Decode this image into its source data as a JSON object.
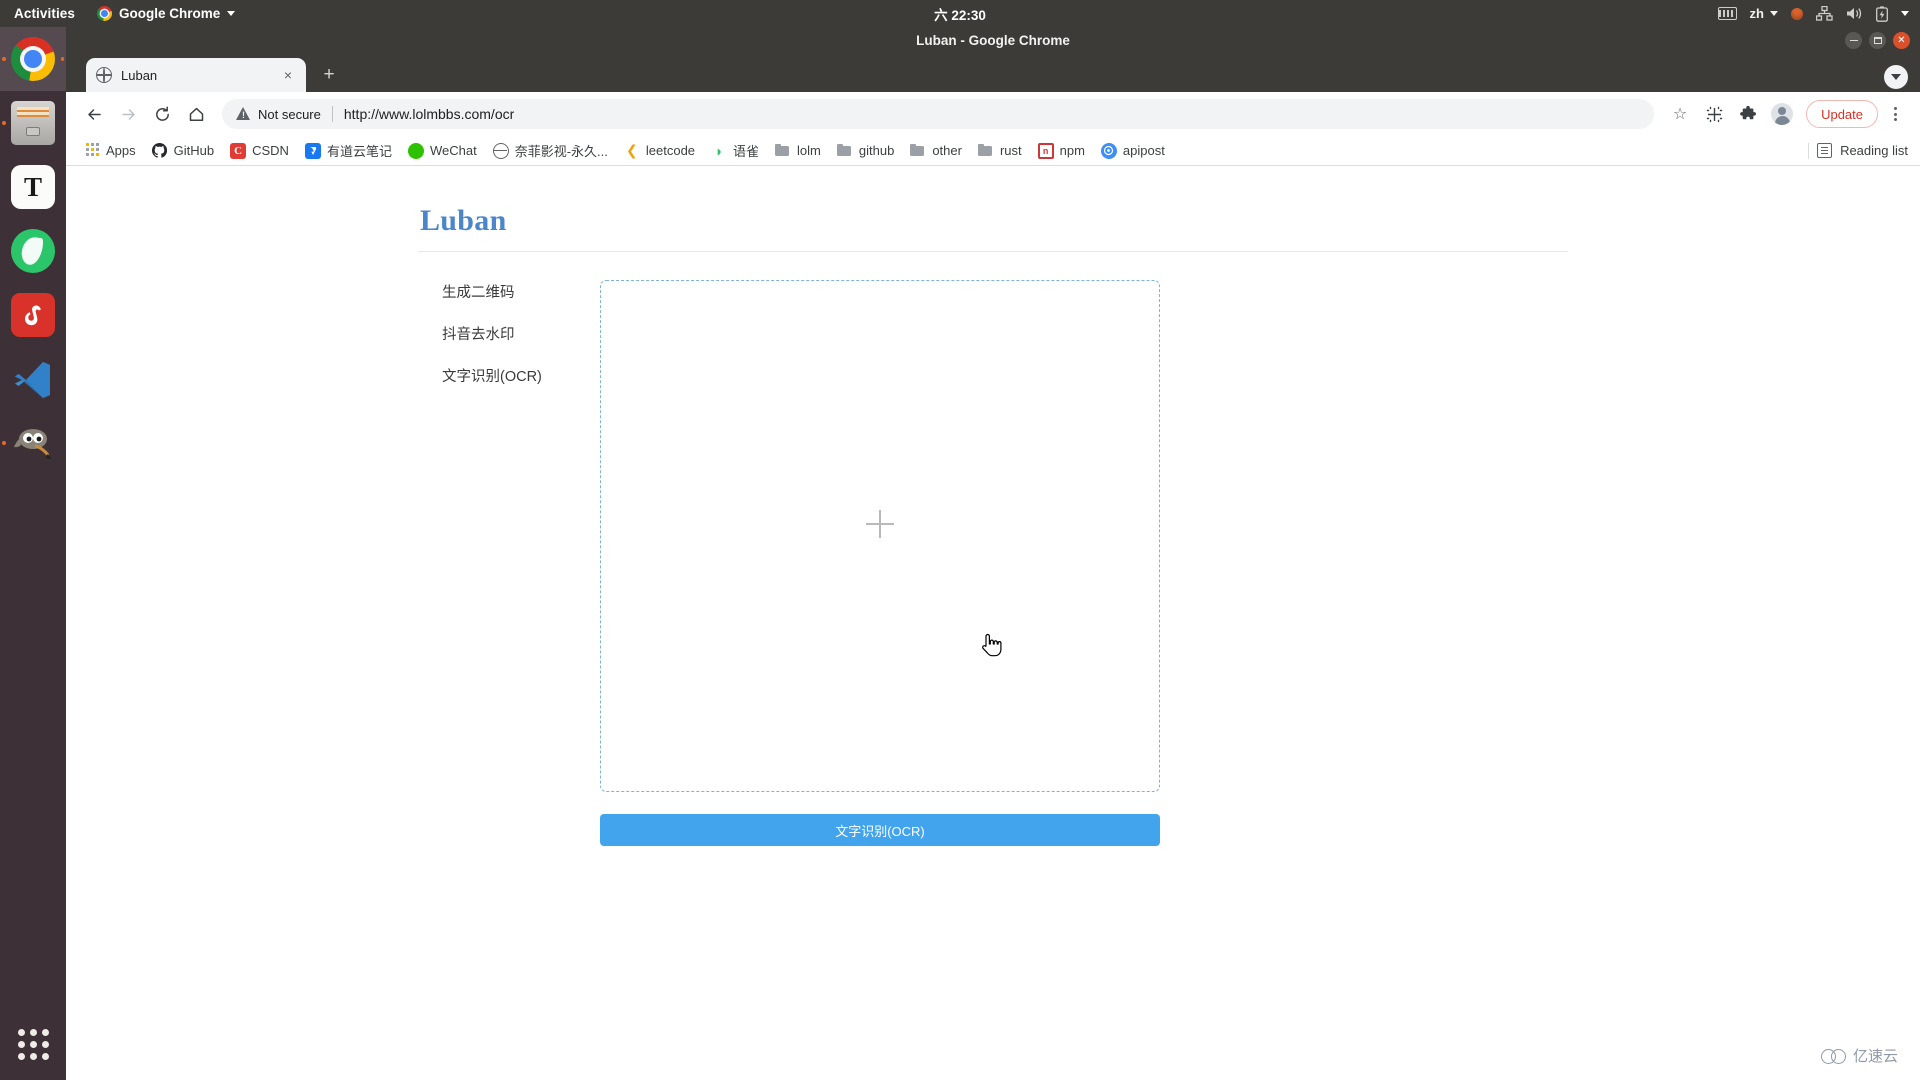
{
  "system_bar": {
    "activities_label": "Activities",
    "app_name": "Google Chrome",
    "app_icon": "chrome-icon",
    "clock": "六 22:30",
    "language": "zh",
    "tray_icons": [
      "keyboard-icon",
      "language-indicator",
      "notification-dot-icon",
      "network-icon",
      "volume-icon",
      "battery-icon",
      "system-menu-caret-icon"
    ]
  },
  "dock": {
    "items": [
      {
        "name": "google-chrome",
        "icon": "chrome-icon",
        "active": true,
        "running": true
      },
      {
        "name": "files",
        "icon": "file-manager-icon",
        "active": false,
        "running": true
      },
      {
        "name": "typora",
        "icon": "typora-icon",
        "label": "T",
        "active": false,
        "running": false
      },
      {
        "name": "yuque",
        "icon": "yuque-bird-icon",
        "active": false,
        "running": false
      },
      {
        "name": "netease-music",
        "icon": "netease-music-icon",
        "label": "ⓖ",
        "active": false,
        "running": false
      },
      {
        "name": "visual-studio-code",
        "icon": "vscode-icon",
        "active": false,
        "running": false
      },
      {
        "name": "gimp",
        "icon": "gimp-icon",
        "active": false,
        "running": true
      }
    ],
    "show_applications_label": "Show Applications"
  },
  "browser": {
    "window_title": "Luban - Google Chrome",
    "window_buttons": [
      "minimize",
      "maximize",
      "close"
    ],
    "tabs": [
      {
        "title": "Luban",
        "favicon": "globe-icon",
        "active": true,
        "close_label": "×"
      }
    ],
    "new_tab_label": "+",
    "toolbar": {
      "back_label": "←",
      "forward_label": "→",
      "reload_label": "⟳",
      "home_label": "⌂",
      "security_text": "Not secure",
      "url": "http://www.lolmbbs.com/ocr",
      "bookmark_star": "☆",
      "cast_icon": "cast-icon",
      "extensions_icon": "puzzle-icon",
      "profile_icon": "profile-avatar-icon",
      "update_label": "Update",
      "menu_icon": "kebab-menu-icon"
    },
    "bookmarks": [
      {
        "label": "Apps",
        "icon": "apps-grid-icon"
      },
      {
        "label": "GitHub",
        "icon": "github-icon"
      },
      {
        "label": "CSDN",
        "icon": "csdn-icon",
        "glyph": "C"
      },
      {
        "label": "有道云笔记",
        "icon": "youdao-note-icon"
      },
      {
        "label": "WeChat",
        "icon": "wechat-icon"
      },
      {
        "label": "奈菲影视-永久...",
        "icon": "globe-icon"
      },
      {
        "label": "leetcode",
        "icon": "leetcode-icon",
        "glyph": "❮"
      },
      {
        "label": "语雀",
        "icon": "yuque-icon",
        "glyph": "◗"
      },
      {
        "label": "lolm",
        "icon": "folder-icon"
      },
      {
        "label": "github",
        "icon": "folder-icon"
      },
      {
        "label": "other",
        "icon": "folder-icon"
      },
      {
        "label": "rust",
        "icon": "folder-icon"
      },
      {
        "label": "npm",
        "icon": "npm-icon",
        "glyph": "n"
      },
      {
        "label": "apipost",
        "icon": "apipost-icon"
      }
    ],
    "reading_list_label": "Reading list"
  },
  "page": {
    "title": "Luban",
    "title_color": "#4a86c8",
    "nav_items": [
      {
        "label": "生成二维码"
      },
      {
        "label": "抖音去水印"
      },
      {
        "label": "文字识别(OCR)"
      }
    ],
    "dropzone": {
      "icon": "plus-icon",
      "border_color": "#7fb3dd"
    },
    "submit_button": {
      "label": "文字识别(OCR)",
      "color": "#41a4ec"
    },
    "watermark": {
      "label": "亿速云",
      "icon": "cloud-logo-icon"
    }
  }
}
